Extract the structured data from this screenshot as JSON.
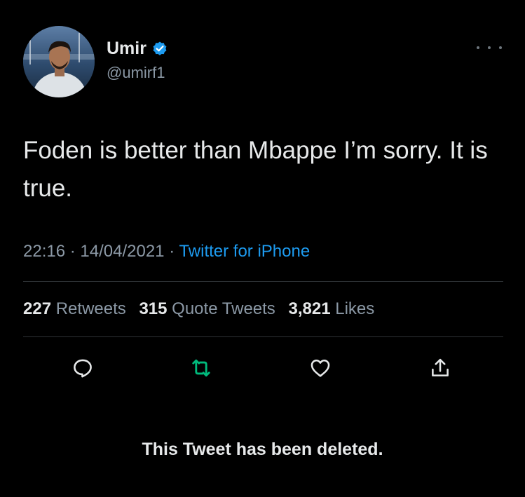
{
  "author": {
    "display_name": "Umir",
    "handle": "@umirf1",
    "verified_icon": "verified-badge-icon",
    "avatar_icon": "avatar-photo"
  },
  "tweet": {
    "text": "Foden is better than Mbappe I’m sorry. It is true.",
    "time": "22:16",
    "date": "14/04/2021",
    "separator": "·",
    "source": "Twitter for iPhone"
  },
  "stats": {
    "retweets_count": "227",
    "retweets_label": "Retweets",
    "quote_tweets_count": "315",
    "quote_tweets_label": "Quote Tweets",
    "likes_count": "3,821",
    "likes_label": "Likes"
  },
  "actions": {
    "reply_icon": "reply-icon",
    "retweet_icon": "retweet-icon",
    "like_icon": "heart-icon",
    "share_icon": "share-icon"
  },
  "notice": {
    "deleted_text": "This Tweet has been deleted."
  },
  "colors": {
    "background": "#000000",
    "text": "#e7e9ea",
    "muted": "#8b98a5",
    "link": "#1d9bf0",
    "retweeted": "#00ba7c",
    "divider": "#2f3336"
  }
}
